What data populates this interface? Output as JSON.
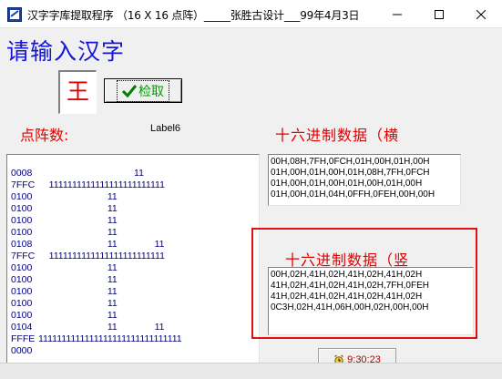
{
  "window": {
    "title": "汉字字库提取程序 （16 X 16 点阵）_____张胜古设计___99年4月3日"
  },
  "input": {
    "prompt": "请输入汉字",
    "value": "王",
    "check_label": "检取"
  },
  "dot_matrix": {
    "label": "点阵数:",
    "info_label": "Label6",
    "rows": [
      {
        "addr": "0008",
        "bits": "                                    11"
      },
      {
        "addr": "7FFC",
        "bits": "    1111111111111111111111111"
      },
      {
        "addr": "0100",
        "bits": "                          11"
      },
      {
        "addr": "0100",
        "bits": "                          11"
      },
      {
        "addr": "0100",
        "bits": "                          11"
      },
      {
        "addr": "0100",
        "bits": "                          11"
      },
      {
        "addr": "0108",
        "bits": "                          11              11"
      },
      {
        "addr": "7FFC",
        "bits": "    1111111111111111111111111"
      },
      {
        "addr": "0100",
        "bits": "                          11"
      },
      {
        "addr": "0100",
        "bits": "                          11"
      },
      {
        "addr": "0100",
        "bits": "                          11"
      },
      {
        "addr": "0100",
        "bits": "                          11"
      },
      {
        "addr": "0100",
        "bits": "                          11"
      },
      {
        "addr": "0104",
        "bits": "                          11              11"
      },
      {
        "addr": "FFFE",
        "bits": "1111111111111111111111111111111"
      },
      {
        "addr": "0000",
        "bits": ""
      }
    ]
  },
  "hex_horizontal": {
    "label": "十六进制数据（横",
    "lines": [
      "00H,08H,7FH,0FCH,01H,00H,01H,00H",
      "01H,00H,01H,00H,01H,08H,7FH,0FCH",
      "01H,00H,01H,00H,01H,00H,01H,00H",
      "01H,00H,01H,04H,0FFH,0FEH,00H,00H"
    ]
  },
  "hex_vertical": {
    "label": "十六进制数据（竖",
    "lines": [
      "00H,02H,41H,02H,41H,02H,41H,02H",
      "41H,02H,41H,02H,41H,02H,7FH,0FEH",
      "41H,02H,41H,02H,41H,02H,41H,02H",
      "0C3H,02H,41H,06H,00H,02H,00H,00H"
    ]
  },
  "clock": {
    "time": "9:30:23"
  },
  "colors": {
    "prompt_blue": "#1515d8",
    "label_red": "#e00000",
    "check_green": "#00a000",
    "highlight_frame": "#e01010"
  },
  "icons": {
    "app": "dot-matrix-app-icon",
    "check": "checkmark-icon",
    "clock": "alarm-clock-icon",
    "minimize": "minimize-icon",
    "maximize": "maximize-icon",
    "close": "close-icon"
  }
}
